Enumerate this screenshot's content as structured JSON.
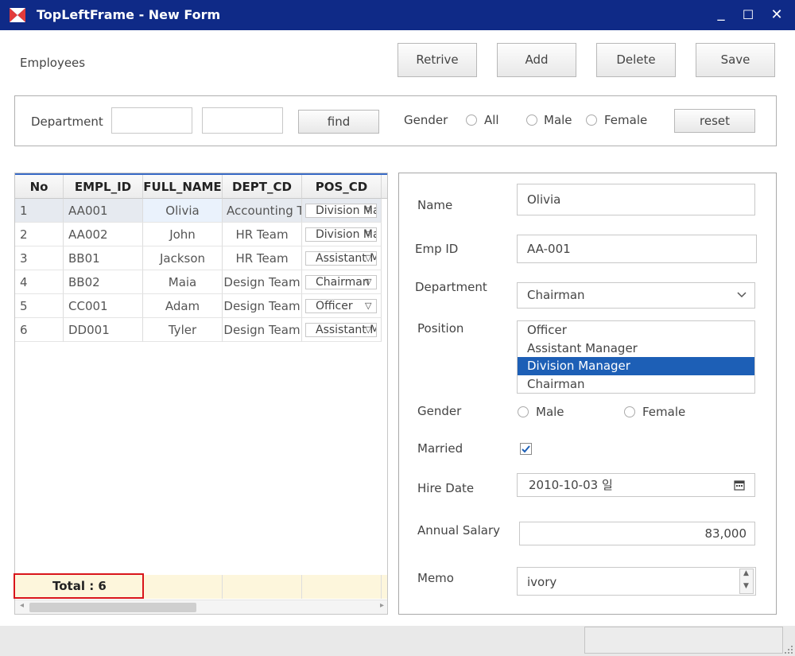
{
  "window": {
    "title": "TopLeftFrame - New Form",
    "minimize": "_",
    "maximize": "☐",
    "close": "✕"
  },
  "header": {
    "section_label": "Employees",
    "buttons": {
      "retrive": "Retrive",
      "add": "Add",
      "delete": "Delete",
      "save": "Save"
    }
  },
  "search": {
    "department_label": "Department",
    "dept_value_1": "",
    "dept_value_2": "",
    "find_label": "find",
    "gender_label": "Gender",
    "gender_options": [
      "All",
      "Male",
      "Female"
    ],
    "reset_label": "reset"
  },
  "grid": {
    "columns": [
      "No",
      "EMPL_ID",
      "FULL_NAME",
      "DEPT_CD",
      "POS_CD"
    ],
    "rows": [
      {
        "no": "1",
        "empl_id": "AA001",
        "full_name": "Olivia",
        "dept_cd": "Accounting Team",
        "pos_cd": "Division Manager"
      },
      {
        "no": "2",
        "empl_id": "AA002",
        "full_name": "John",
        "dept_cd": "HR Team",
        "pos_cd": "Division Manager"
      },
      {
        "no": "3",
        "empl_id": "BB01",
        "full_name": "Jackson",
        "dept_cd": "HR Team",
        "pos_cd": "Assistant Manager"
      },
      {
        "no": "4",
        "empl_id": "BB02",
        "full_name": "Maia",
        "dept_cd": "Design Team",
        "pos_cd": "Chairman"
      },
      {
        "no": "5",
        "empl_id": "CC001",
        "full_name": "Adam",
        "dept_cd": "Design Team",
        "pos_cd": "Officer"
      },
      {
        "no": "6",
        "empl_id": "DD001",
        "full_name": "Tyler",
        "dept_cd": "Design Team",
        "pos_cd": "Assistant Manager"
      }
    ],
    "total_label": "Total : 6"
  },
  "detail": {
    "name_label": "Name",
    "name_value": "Olivia",
    "empid_label": "Emp ID",
    "empid_value": "AA-001",
    "dept_label": "Department",
    "dept_value": "Chairman",
    "position_label": "Position",
    "position_options": [
      "Officer",
      "Assistant Manager",
      "Division Manager",
      "Chairman"
    ],
    "position_selected": "Division Manager",
    "gender_label": "Gender",
    "gender_options": [
      "Male",
      "Female"
    ],
    "married_label": "Married",
    "married_checked": true,
    "hiredate_label": "Hire Date",
    "hiredate_value": "2010-10-03 일",
    "salary_label": "Annual Salary",
    "salary_value": "83,000",
    "memo_label": "Memo",
    "memo_value": "ivory"
  },
  "colors": {
    "titlebar": "#0f2a87",
    "selection": "#1d5fb6",
    "total_highlight": "#d9151b",
    "footer_bg": "#fdf6dc"
  }
}
